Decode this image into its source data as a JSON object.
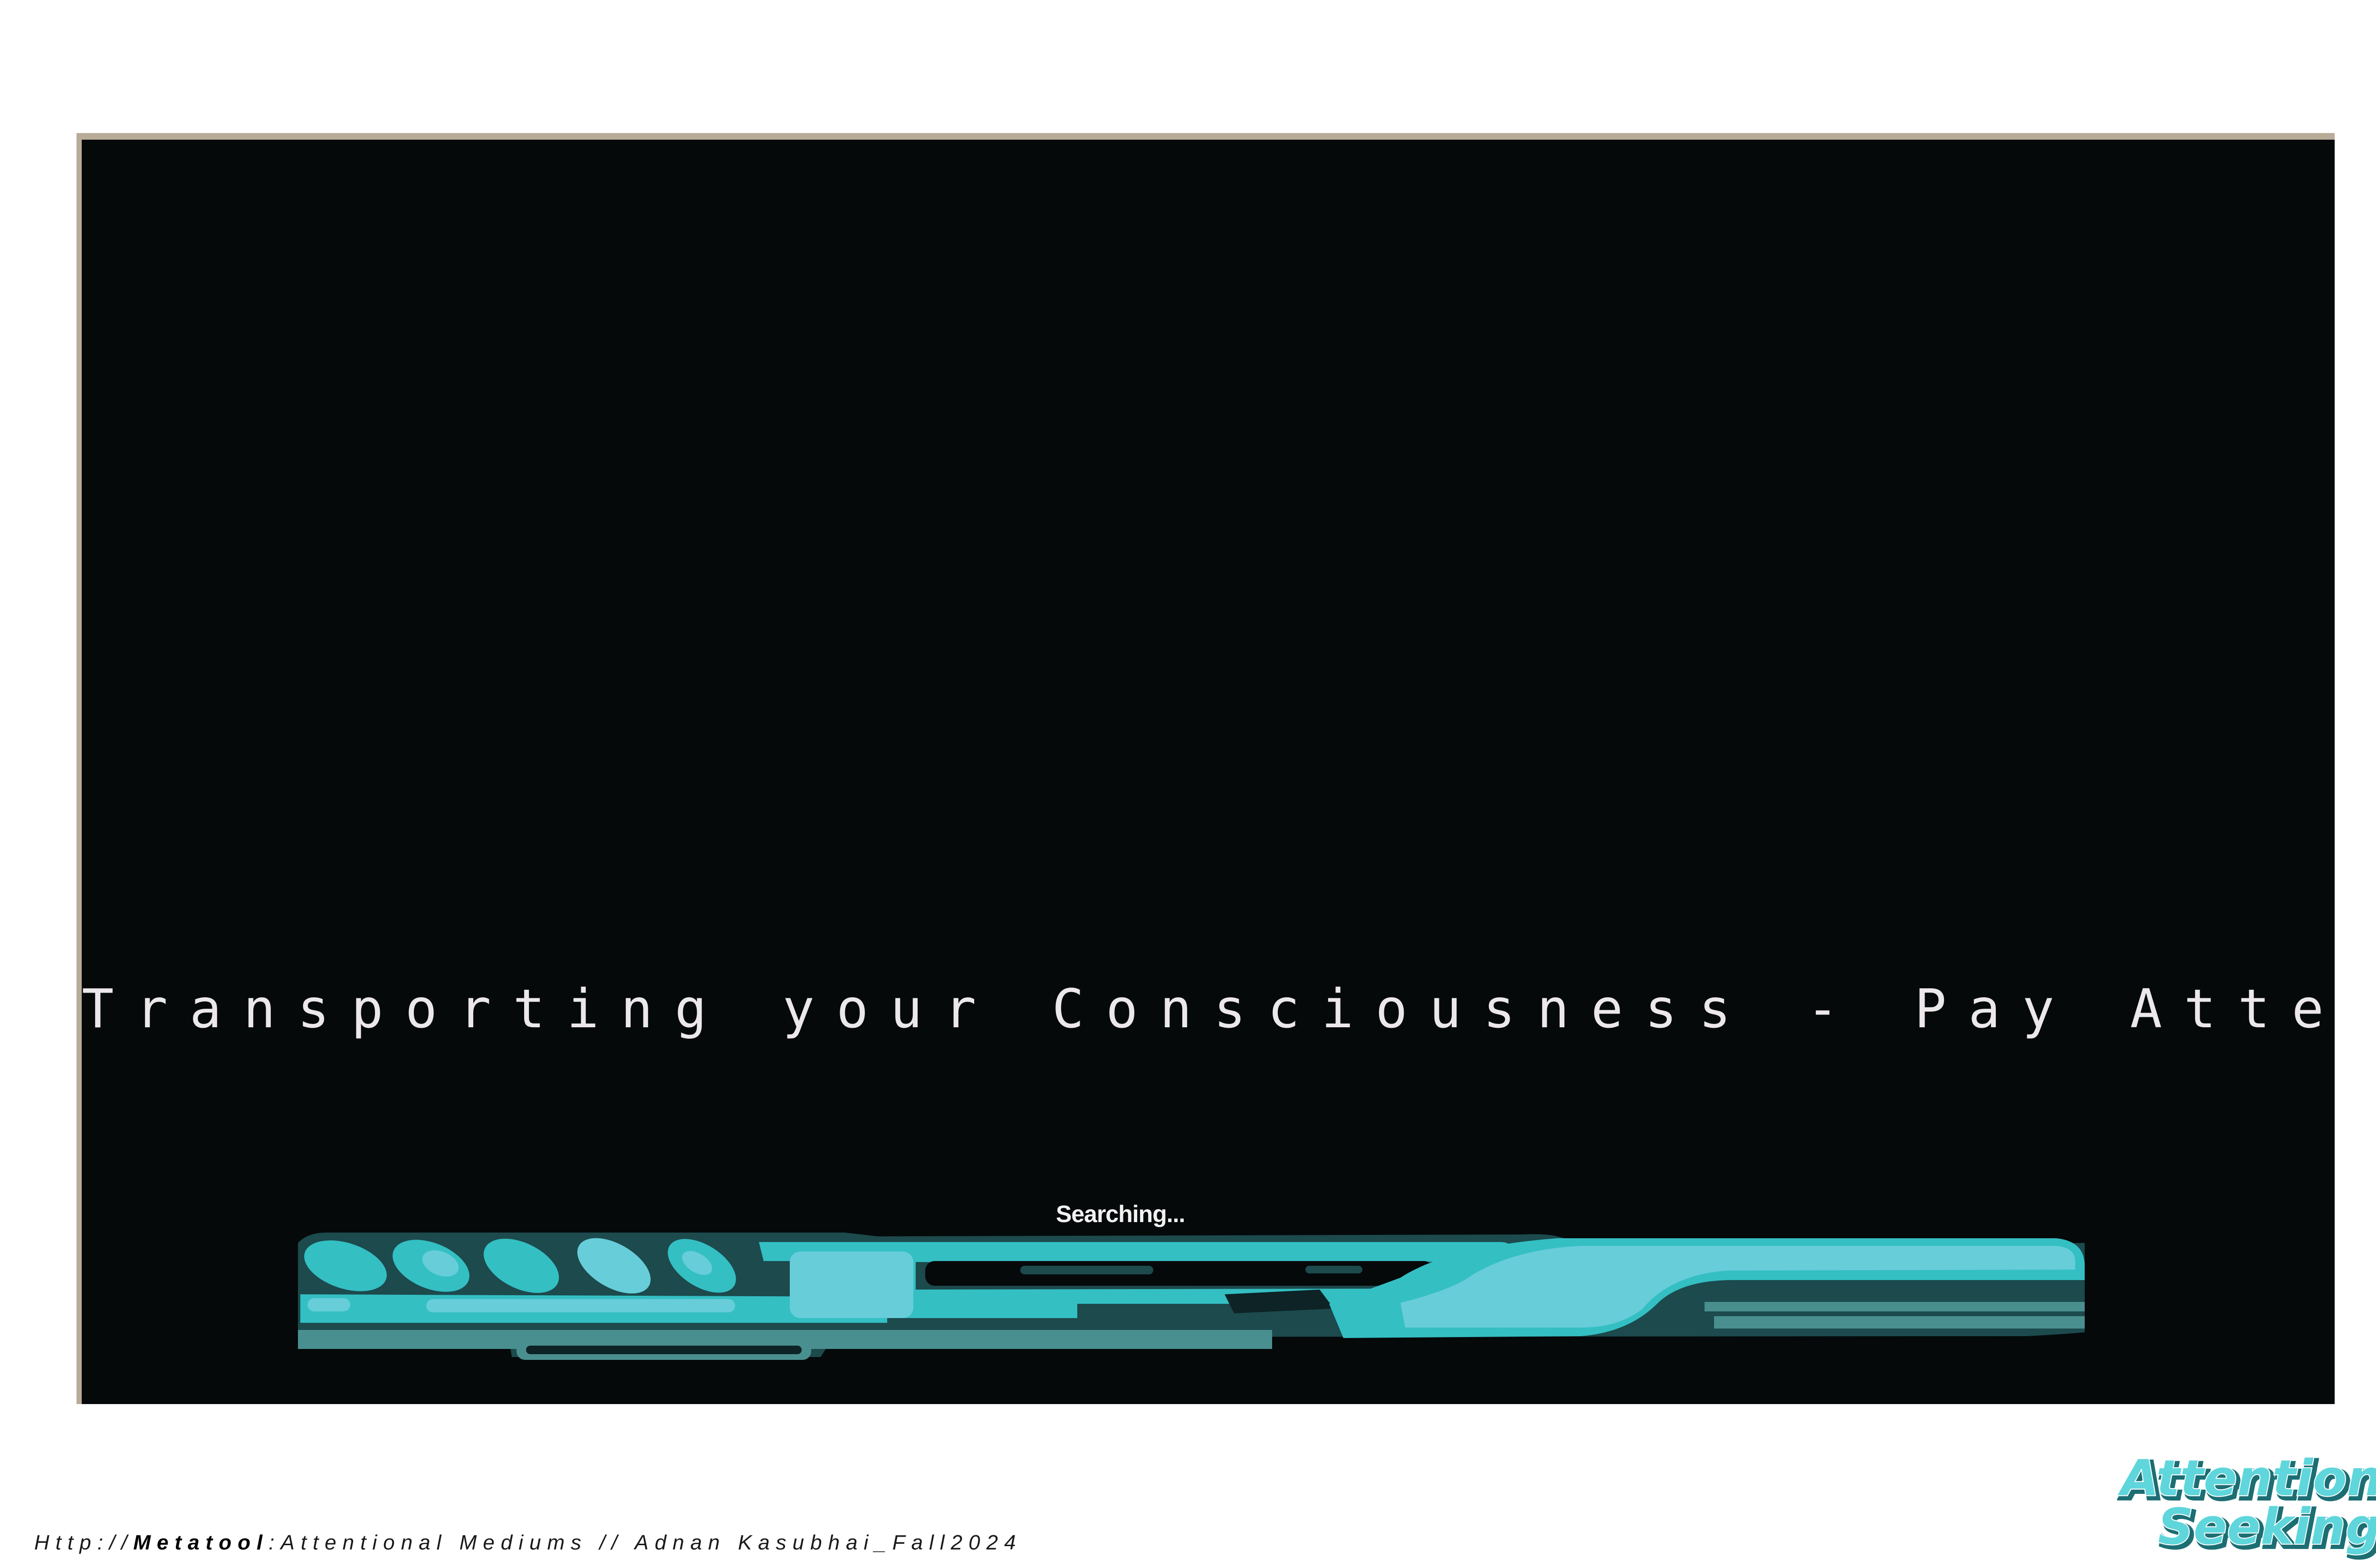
{
  "screen": {
    "headline": "Transporting your Consciousness - Pay Attention",
    "status_text": "Searching...",
    "loader_fill_percent": 100,
    "colors": {
      "background": "#05090a",
      "accent_light": "#67cdd9",
      "accent_mid": "#34bfc3",
      "accent_dark": "#4a8f90",
      "outline": "#1c4a4d"
    }
  },
  "footer": {
    "prefix": "Http://",
    "brand": "Metatool",
    "suffix": ":Attentional Mediums // Adnan Kasubhai_Fall2024"
  },
  "logo": {
    "line1": "Attention",
    "line2": "Seeking",
    "color": "#4fd1d6"
  }
}
